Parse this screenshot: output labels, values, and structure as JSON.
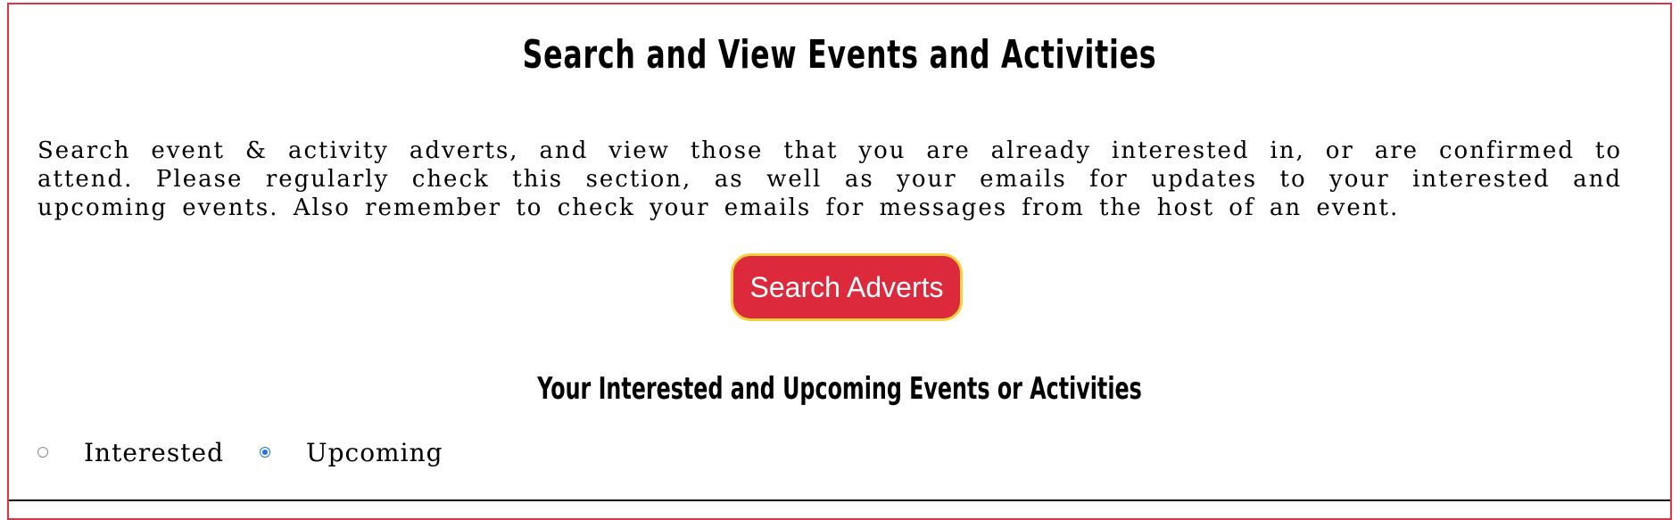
{
  "header": {
    "title": "Search and View Events and Activities"
  },
  "intro": {
    "text": "Search event & activity adverts, and view those that you are already interested in, or are confirmed to attend. Please regularly check this section, as well as your emails for updates to your interested and upcoming events. Also remember to check your emails for messages from the host of an event."
  },
  "actions": {
    "search_label": "Search Adverts"
  },
  "events_section": {
    "title": "Your Interested and Upcoming Events or Activities",
    "filter": {
      "options": [
        {
          "label": "Interested",
          "checked": false
        },
        {
          "label": "Upcoming",
          "checked": true
        }
      ]
    }
  },
  "colors": {
    "panel_border": "#dc3545",
    "button_bg": "#dc2a3c",
    "button_border": "#f3d23b",
    "radio_selected": "#1a73e8"
  }
}
